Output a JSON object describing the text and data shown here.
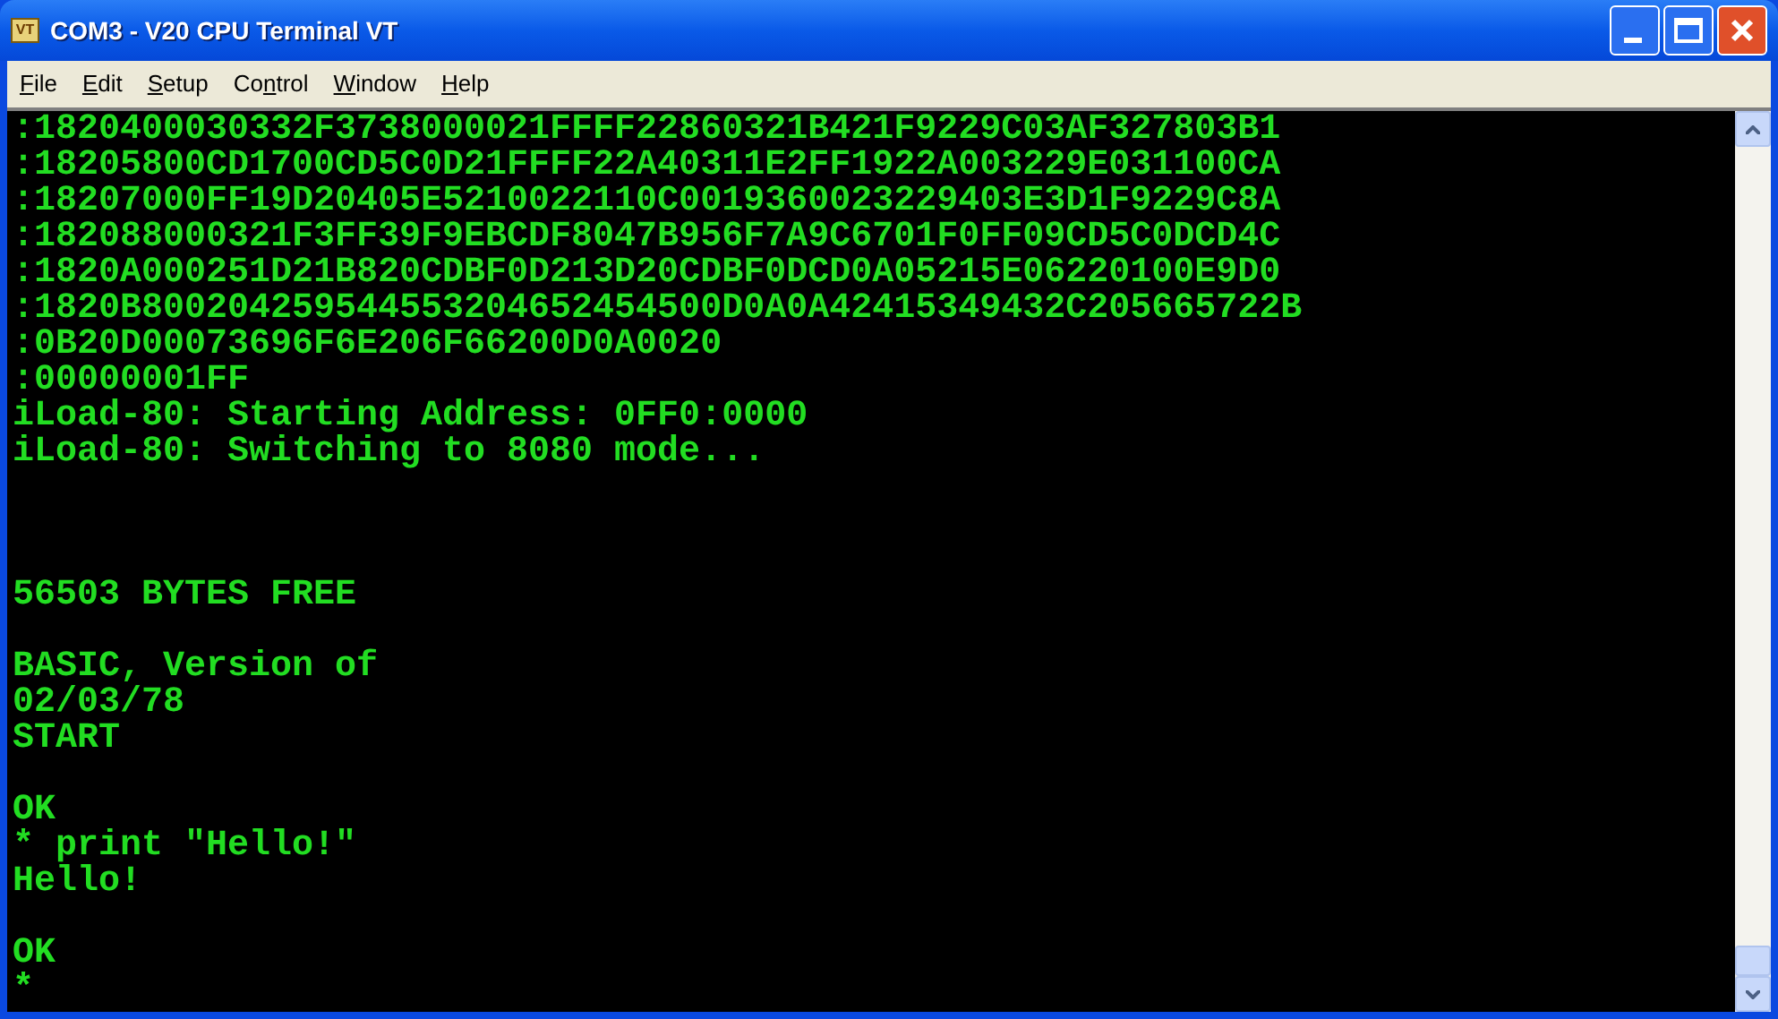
{
  "window": {
    "title": "COM3 - V20 CPU Terminal VT",
    "app_icon": "VT"
  },
  "menu": [
    {
      "key": "F",
      "after": "ile"
    },
    {
      "key": "E",
      "after": "dit"
    },
    {
      "key": "S",
      "after": "etup"
    },
    {
      "before": "Co",
      "key": "n",
      "after": "trol"
    },
    {
      "key": "W",
      "after": "indow"
    },
    {
      "key": "H",
      "after": "elp"
    }
  ],
  "terminal": {
    "lines": [
      {
        "kind": "text",
        "text": ":1820400030332F3738000021FFFF22860321B421F9229C03AF327803B1"
      },
      {
        "kind": "text",
        "text": ":18205800CD1700CD5C0D21FFFF22A40311E2FF1922A003229E031100CA"
      },
      {
        "kind": "text",
        "text": ":18207000FF19D20405E5210022110C0019360023229403E3D1F9229C8A"
      },
      {
        "kind": "text",
        "text": ":182088000321F3FF39F9EBCDF8047B956F7A9C6701F0FF09CD5C0DCD4C"
      },
      {
        "kind": "text",
        "text": ":1820A000251D21B820CDBF0D213D20CDBF0DCD0A05215E06220100E9D0"
      },
      {
        "kind": "text",
        "text": ":1820B800204259544553204652454500D0A0A42415349432C205665722B"
      },
      {
        "kind": "text",
        "text": ":0B20D00073696F6E206F66200D0A0020"
      },
      {
        "kind": "text",
        "text": ":00000001FF"
      },
      {
        "kind": "text",
        "text": "iLoad-80: Starting Address: 0FF0:0000"
      },
      {
        "kind": "text",
        "text": "iLoad-80: Switching to 8080 mode..."
      },
      {
        "kind": "blank"
      },
      {
        "kind": "blank"
      },
      {
        "kind": "blank"
      },
      {
        "kind": "text",
        "text": "56503 BYTES FREE"
      },
      {
        "kind": "blank"
      },
      {
        "kind": "text",
        "text": "BASIC, Version of"
      },
      {
        "kind": "text",
        "text": "02/03/78"
      },
      {
        "kind": "text",
        "text": "START"
      },
      {
        "kind": "blank"
      },
      {
        "kind": "text",
        "text": "OK"
      },
      {
        "kind": "text",
        "text": "* print \"Hello!\""
      },
      {
        "kind": "text",
        "text": "Hello!"
      },
      {
        "kind": "blank"
      },
      {
        "kind": "text",
        "text": "OK"
      },
      {
        "kind": "text",
        "text": "*"
      }
    ]
  }
}
